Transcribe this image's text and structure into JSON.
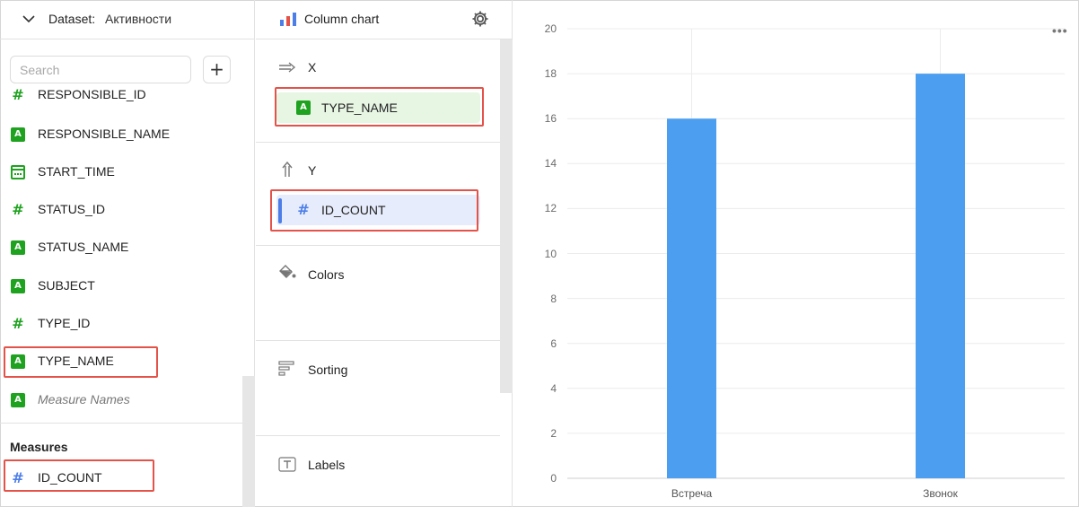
{
  "dataset": {
    "label": "Dataset:",
    "name": "Активности"
  },
  "search": {
    "placeholder": "Search"
  },
  "add_label": "+",
  "dimensions": [
    {
      "label": "RESPONSIBLE_ID",
      "icon": "hash-icon"
    },
    {
      "label": "RESPONSIBLE_NAME",
      "icon": "string-a-icon"
    },
    {
      "label": "START_TIME",
      "icon": "date-icon"
    },
    {
      "label": "STATUS_ID",
      "icon": "hash-icon"
    },
    {
      "label": "STATUS_NAME",
      "icon": "string-a-icon"
    },
    {
      "label": "SUBJECT",
      "icon": "string-a-icon"
    },
    {
      "label": "TYPE_ID",
      "icon": "hash-icon"
    },
    {
      "label": "TYPE_NAME",
      "icon": "string-a-icon"
    },
    {
      "label": "Measure Names",
      "icon": "string-a-icon"
    }
  ],
  "measures": {
    "title": "Measures",
    "items": [
      {
        "label": "ID_COUNT",
        "icon": "hash-icon"
      }
    ]
  },
  "visualization": {
    "title": "Column chart",
    "sections": {
      "x": {
        "title": "X",
        "field": "TYPE_NAME"
      },
      "y": {
        "title": "Y",
        "field": "ID_COUNT"
      },
      "colors": {
        "title": "Colors"
      },
      "sorting": {
        "title": "Sorting"
      },
      "labels": {
        "title": "Labels"
      }
    }
  },
  "colors": {
    "bar": "#4c9ff0",
    "dimension_icon": "#1ea21f",
    "measure_icon": "#4d7ee8",
    "highlight": "#e45349"
  },
  "chart_data": {
    "type": "bar",
    "categories": [
      "Встреча",
      "Звонок"
    ],
    "values": [
      16,
      18
    ],
    "ylim": [
      0,
      20
    ],
    "yticks": [
      "0",
      "2",
      "4",
      "6",
      "8",
      "10",
      "12",
      "14",
      "16",
      "18",
      "20"
    ],
    "grid": true,
    "legend": "none"
  },
  "menu_label": "•••"
}
